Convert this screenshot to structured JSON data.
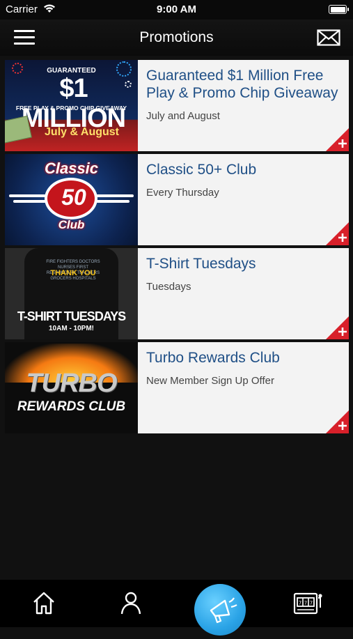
{
  "status_bar": {
    "carrier": "Carrier",
    "time": "9:00 AM"
  },
  "nav": {
    "title": "Promotions"
  },
  "promotions": [
    {
      "title": "Guaranteed $1 Million Free Play & Promo Chip Giveaway",
      "subtitle": "July and August",
      "image_text": {
        "line1": "GUARANTEED",
        "line2": "$1 MILLION",
        "line3": "FREE PLAY & PROMO CHIP GIVEAWAY",
        "line4": "July & August"
      }
    },
    {
      "title": "Classic 50+ Club",
      "subtitle": "Every Thursday",
      "image_text": {
        "word1": "Classic",
        "number": "50",
        "word2": "Club"
      }
    },
    {
      "title": "T-Shirt Tuesdays",
      "subtitle": "Tuesdays",
      "image_text": {
        "words": "FIRE FIGHTERS DOCTORS NURSES FIRST RESPONDERS TEACHERS GROCERS HOSPITALS",
        "thanks": "THANK YOU",
        "big": "T-SHIRT TUESDAYS",
        "hours": "10AM - 10PM!"
      }
    },
    {
      "title": "Turbo Rewards Club",
      "subtitle": "New Member Sign Up Offer",
      "image_text": {
        "word1": "TURBO",
        "word2": "REWARDS CLUB"
      }
    }
  ],
  "tabs": [
    {
      "name": "home-icon"
    },
    {
      "name": "profile-icon"
    },
    {
      "name": "megaphone-icon"
    },
    {
      "name": "slot-machine-icon"
    }
  ],
  "colors": {
    "title_blue": "#1f4f86",
    "corner_red": "#d8202a",
    "center_button_blue": "#2aa3e6"
  }
}
